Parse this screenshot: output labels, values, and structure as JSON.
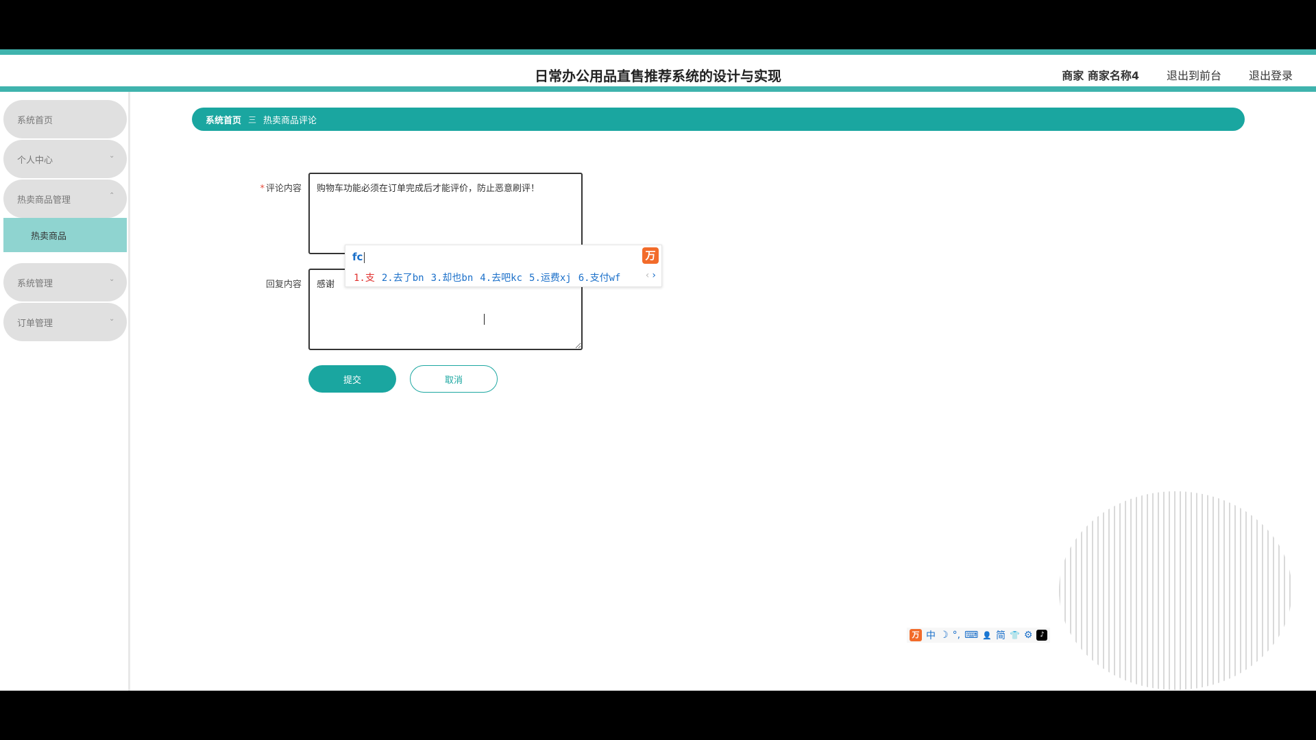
{
  "header": {
    "title": "日常办公用品直售推荐系统的设计与实现",
    "user_role_name": "商家 商家名称4",
    "back_front": "退出到前台",
    "logout": "退出登录"
  },
  "sidebar": {
    "items": [
      {
        "label": "系统首页"
      },
      {
        "label": "个人中心"
      },
      {
        "label": "热卖商品管理"
      },
      {
        "label": "系统管理"
      },
      {
        "label": "订单管理"
      }
    ],
    "subitem_active": "热卖商品"
  },
  "breadcrumb": {
    "home": "系统首页",
    "separator": "三",
    "current": "热卖商品评论"
  },
  "form": {
    "required_mark": "*",
    "comment_label": "评论内容",
    "comment_value": "购物车功能必须在订单完成后才能评价，防止恶意刷评！",
    "reply_label": "回复内容",
    "reply_value": "感谢",
    "submit_label": "提交",
    "cancel_label": "取消"
  },
  "ime": {
    "code": "fc",
    "candidates": [
      "1.支",
      "2.去了bn",
      "3.却也bn",
      "4.去吧kc",
      "5.运费xj",
      "6.支付wf"
    ],
    "prev_arrow": "‹",
    "next_arrow": "›",
    "logo_glyph": "万",
    "toolbar": {
      "logo": "万",
      "lang": "中",
      "moon": "☽",
      "punct": "°,",
      "keyboard": "⌨",
      "user": "👤",
      "simplified": "简",
      "skin": "👕",
      "settings": "⚙",
      "tiktok": "♪"
    }
  },
  "colors": {
    "accent": "#1aa6a0",
    "topbar_border": "#3fb3ad",
    "submenu_bg": "#8fd4d0",
    "menu_bg": "#e0e0e0"
  }
}
